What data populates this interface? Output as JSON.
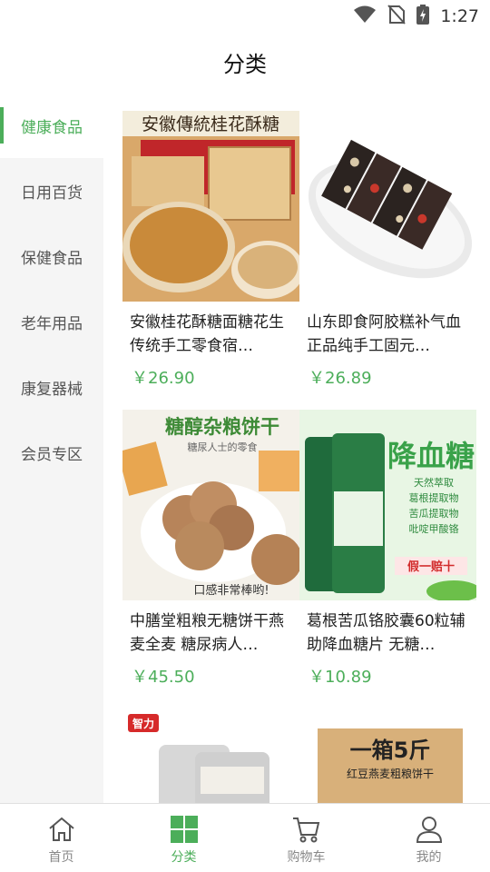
{
  "status_bar": {
    "time": "1:27",
    "icons": [
      "wifi-icon",
      "no-sim-icon",
      "battery-charging-icon"
    ]
  },
  "header": {
    "title": "分类"
  },
  "sidebar": {
    "items": [
      {
        "label": "健康食品",
        "active": true
      },
      {
        "label": "日用百货",
        "active": false
      },
      {
        "label": "保健食品",
        "active": false
      },
      {
        "label": "老年用品",
        "active": false
      },
      {
        "label": "康复器械",
        "active": false
      },
      {
        "label": "会员专区",
        "active": false
      }
    ]
  },
  "products": [
    {
      "name": "安徽桂花酥糖面糖花生传统手工零食宿…",
      "price": "￥26.90",
      "image_text": "安徽傳統桂花酥糖"
    },
    {
      "name": "山东即食阿胶糕补气血正品纯手工固元…",
      "price": "￥26.89"
    },
    {
      "name": "中膳堂粗粮无糖饼干燕麦全麦 糖尿病人…",
      "price": "￥45.50",
      "image_text": "糖醇杂粮饼干",
      "image_subtext": "糖尿人士的零食",
      "image_footer": "口感非常棒哟!"
    },
    {
      "name": "葛根苦瓜铬胶囊60粒辅助降血糖片 无糖…",
      "price": "￥10.89",
      "image_text": "降血糖",
      "image_lines": [
        "天然萃取",
        "葛根提取物",
        "苦瓜提取物",
        "吡啶甲酸铬"
      ],
      "image_badge": "假一赔十"
    },
    {
      "name": "",
      "price": "",
      "image_text": "智力"
    },
    {
      "name": "",
      "price": "",
      "image_text": "一箱5斤",
      "image_subtext": "红豆燕麦粗粮饼干"
    }
  ],
  "bottom_nav": {
    "items": [
      {
        "label": "首页",
        "icon": "home-icon",
        "active": false
      },
      {
        "label": "分类",
        "icon": "category-grid-icon",
        "active": true
      },
      {
        "label": "购物车",
        "icon": "cart-icon",
        "active": false
      },
      {
        "label": "我的",
        "icon": "profile-icon",
        "active": false
      }
    ]
  },
  "colors": {
    "accent": "#4cae5a",
    "sidebar_bg": "#f5f5f5",
    "text": "#222222"
  }
}
